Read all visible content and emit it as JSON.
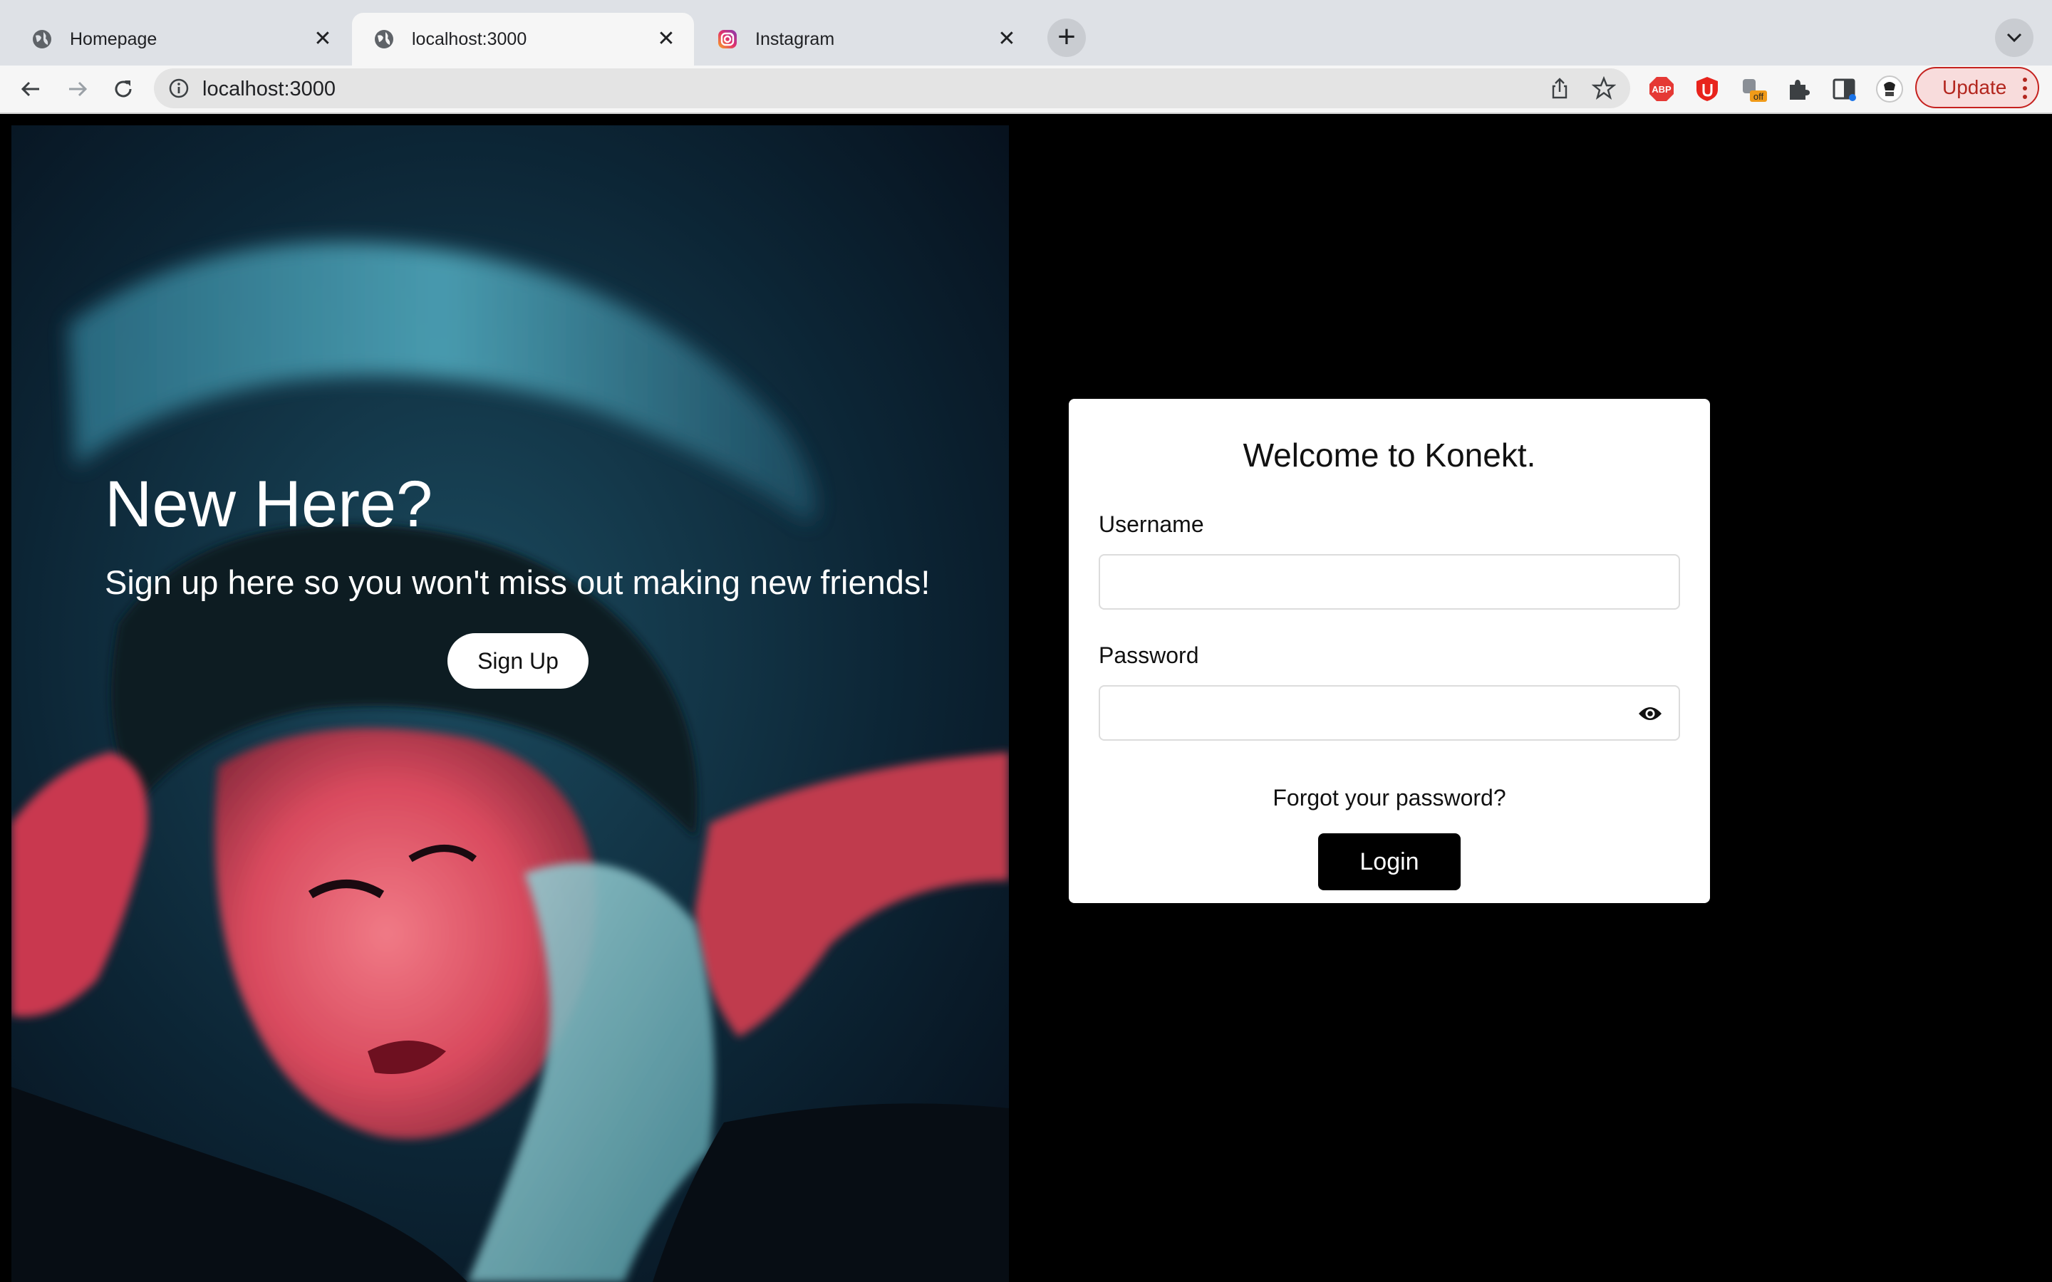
{
  "browser": {
    "tabs": [
      {
        "title": "Homepage",
        "icon": "globe-icon",
        "active": false
      },
      {
        "title": "localhost:3000",
        "icon": "globe-icon",
        "active": true
      },
      {
        "title": "Instagram",
        "icon": "instagram-icon",
        "active": false
      }
    ],
    "url": "localhost:3000",
    "update_label": "Update",
    "extensions": [
      "adblock-plus-icon",
      "ublock-icon",
      "off-badge-extension-icon",
      "puzzle-extensions-icon",
      "side-panel-icon",
      "profile-avatar-icon"
    ],
    "extension_badges": {
      "off": "off",
      "abp": "ABP"
    }
  },
  "hero": {
    "title": "New Here?",
    "subtitle": "Sign up here so you won't miss out making new friends!",
    "signup_label": "Sign Up"
  },
  "login": {
    "title": "Welcome to Konekt.",
    "username_label": "Username",
    "username_value": "",
    "password_label": "Password",
    "password_value": "",
    "forgot_label": "Forgot your password?",
    "login_label": "Login"
  },
  "colors": {
    "page_background": "#000000",
    "card_background": "#ffffff",
    "login_button": "#000000",
    "update_accent": "#c5221f"
  }
}
